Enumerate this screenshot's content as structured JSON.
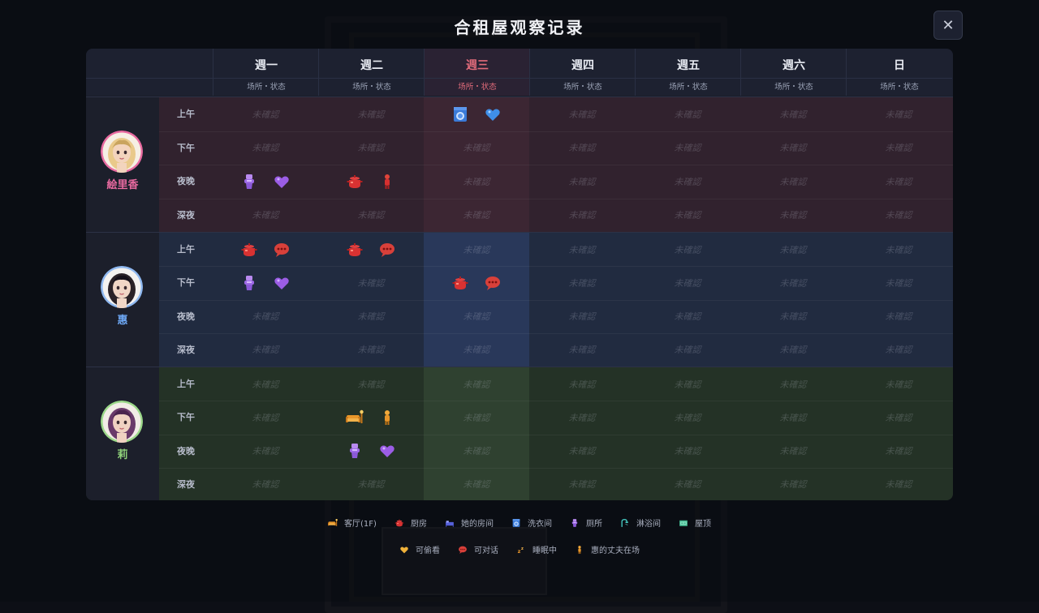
{
  "title": "合租屋观察记录",
  "close_label": "✕",
  "days": [
    {
      "name": "週一",
      "sub": "场所・状态"
    },
    {
      "name": "週二",
      "sub": "场所・状态"
    },
    {
      "name": "週三",
      "sub": "场所・状态",
      "today": true
    },
    {
      "name": "週四",
      "sub": "场所・状态"
    },
    {
      "name": "週五",
      "sub": "场所・状态"
    },
    {
      "name": "週六",
      "sub": "场所・状态"
    },
    {
      "name": "日",
      "sub": "场所・状态"
    }
  ],
  "slots": [
    "上午",
    "下午",
    "夜晚",
    "深夜"
  ],
  "unconfirmed_text": "未確認",
  "characters": [
    {
      "name": "絵里香",
      "color": "#e86aa0",
      "bg": "#31222e",
      "today_bg": "#3c2633",
      "avatar": "blonde-woman-avatar",
      "ring": "#e86aa0",
      "schedule": [
        [
          null,
          null,
          [
            "laundry",
            "heart-blue"
          ],
          null,
          null,
          null,
          null
        ],
        [
          null,
          null,
          null,
          null,
          null,
          null,
          null
        ],
        [
          [
            "toilet",
            "heart-purple"
          ],
          [
            "kitchen",
            "husband-red"
          ],
          null,
          null,
          null,
          null,
          null
        ],
        [
          null,
          null,
          null,
          null,
          null,
          null,
          null
        ]
      ]
    },
    {
      "name": "惠",
      "color": "#6ea8f5",
      "bg": "#212b40",
      "today_bg": "#29385a",
      "avatar": "dark-haired-woman-avatar",
      "ring": "#8fb8f0",
      "schedule": [
        [
          [
            "kitchen",
            "chat"
          ],
          [
            "kitchen",
            "chat"
          ],
          null,
          null,
          null,
          null,
          null
        ],
        [
          [
            "toilet",
            "heart-purple"
          ],
          null,
          [
            "kitchen",
            "chat"
          ],
          null,
          null,
          null,
          null
        ],
        [
          null,
          null,
          null,
          null,
          null,
          null,
          null
        ],
        [
          null,
          null,
          null,
          null,
          null,
          null,
          null
        ]
      ]
    },
    {
      "name": "莉",
      "color": "#8fd07a",
      "bg": "#243226",
      "today_bg": "#2f4130",
      "avatar": "purple-haired-woman-avatar",
      "ring": "#9bd889",
      "schedule": [
        [
          null,
          null,
          null,
          null,
          null,
          null,
          null
        ],
        [
          null,
          [
            "living-room",
            "husband-gold"
          ],
          null,
          null,
          null,
          null,
          null
        ],
        [
          null,
          [
            "toilet",
            "heart-purple"
          ],
          null,
          null,
          null,
          null,
          null
        ],
        [
          null,
          null,
          null,
          null,
          null,
          null,
          null
        ]
      ]
    }
  ],
  "legend_row1": [
    {
      "icon": "sofa-icon",
      "label": "客厅(1F)"
    },
    {
      "icon": "pot-icon",
      "label": "厨房"
    },
    {
      "icon": "bed-icon",
      "label": "她的房间"
    },
    {
      "icon": "washer-icon",
      "label": "洗衣间"
    },
    {
      "icon": "toilet-icon",
      "label": "厕所"
    },
    {
      "icon": "shower-icon",
      "label": "淋浴间"
    },
    {
      "icon": "roof-icon",
      "label": "屋顶"
    }
  ],
  "legend_row2": [
    {
      "icon": "peek-heart-icon",
      "label": "可偷看"
    },
    {
      "icon": "chat-bubble-icon",
      "label": "可对话"
    },
    {
      "icon": "sleeping-icon",
      "label": "睡眠中"
    },
    {
      "icon": "husband-icon",
      "label": "惠的丈夫在场"
    }
  ]
}
